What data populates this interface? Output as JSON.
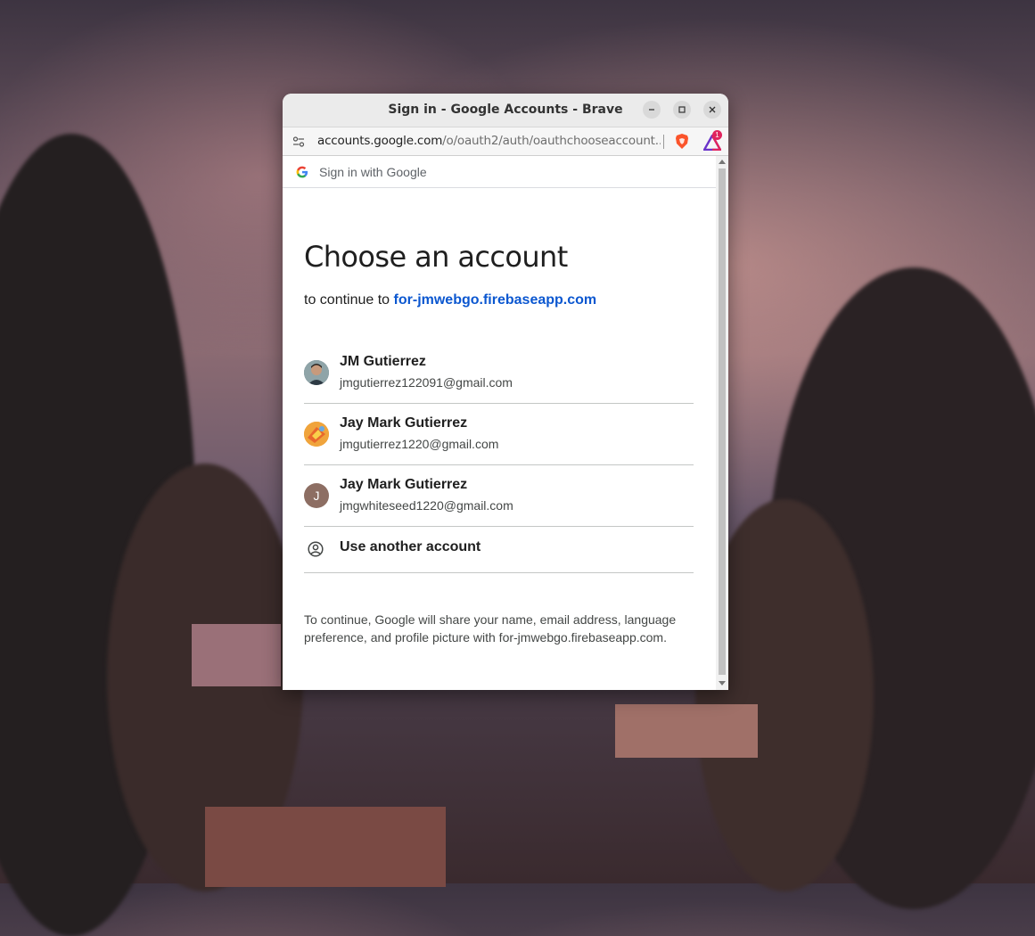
{
  "window": {
    "title": "Sign in - Google Accounts - Brave",
    "controls": [
      "minimize",
      "maximize",
      "close"
    ]
  },
  "addressbar": {
    "url_host": "accounts.google.com",
    "url_path": "/o/oauth2/auth/oauthchooseaccount...",
    "rewards_badge": "1"
  },
  "google_bar": {
    "label": "Sign in with Google"
  },
  "page": {
    "heading": "Choose an account",
    "subtitle_prefix": "to continue to",
    "subtitle_link": "for-jmwebgo.firebaseapp.com",
    "accounts": [
      {
        "name": "JM Gutierrez",
        "email": "jmgutierrez122091@gmail.com"
      },
      {
        "name": "Jay Mark Gutierrez",
        "email": "jmgutierrez1220@gmail.com"
      },
      {
        "name": "Jay Mark Gutierrez",
        "email": "jmgwhiteseed1220@gmail.com",
        "initial": "J"
      }
    ],
    "use_another": "Use another account",
    "consent_line1": "To continue, Google will share your name, email address, language",
    "consent_line2": "preference, and profile picture with for-jmwebgo.firebaseapp.com."
  },
  "colors": {
    "link": "#0b57d0",
    "avatar_j": "#8d6e63"
  }
}
